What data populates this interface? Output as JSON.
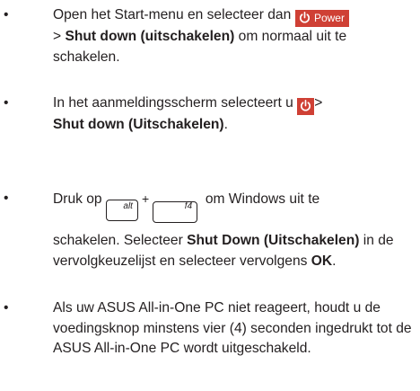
{
  "items": [
    {
      "bullet": "•",
      "pre": "Open het Start-menu en selecteer dan",
      "power_button_label": "Power",
      "line2_pre": "> ",
      "bold": "Shut down (uitschakelen)",
      "post": " om normaal uit te schakelen."
    },
    {
      "bullet": "•",
      "pre": "In het aanmeldingsscherm selecteert u",
      "arrow": ">",
      "bold": "Shut down (Uitschakelen)",
      "post": "."
    },
    {
      "bullet": "•",
      "pre": "Druk op",
      "key1": "alt",
      "plus": "+",
      "key2": "f4",
      "mid": "om Windows uit te",
      "line2_pre": "schakelen. Selecteer ",
      "bold": "Shut Down (Uitschakelen)",
      "post": " in de vervolgkeuzelijst en selecteer vervolgens ",
      "bold2": "OK",
      "post2": "."
    },
    {
      "bullet": "•",
      "text": "Als uw ASUS All-in-One PC niet reageert, houdt u de voedingsknop minstens vier (4) seconden ingedrukt tot de ASUS All-in-One PC wordt uitgeschakeld."
    }
  ],
  "colors": {
    "power_button_bg": "#cf4035",
    "text": "#231f20"
  },
  "icons": {
    "power": "power-icon"
  }
}
